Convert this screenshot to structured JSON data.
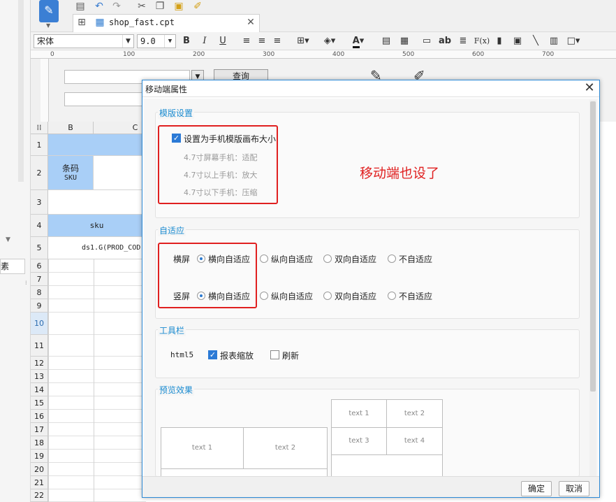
{
  "left_panel": {
    "tab_label": "素"
  },
  "file_tab": {
    "name": "shop_fast.cpt"
  },
  "format_bar": {
    "font_name": "宋体",
    "font_size": "9.0",
    "bold": "B",
    "italic": "I",
    "underline": "U",
    "font_color_label": "A",
    "ab_label": "ab",
    "fx_label": "F(x)"
  },
  "ruler": {
    "ticks": [
      "0",
      "100",
      "200",
      "300",
      "400",
      "500",
      "600",
      "700"
    ]
  },
  "param_pane": {
    "query_button": "查询"
  },
  "sheet": {
    "columns": [
      "B",
      "C"
    ],
    "rows": [
      "1",
      "2",
      "3",
      "4",
      "5",
      "6",
      "7",
      "8",
      "9",
      "10",
      "11",
      "12",
      "13",
      "14",
      "15",
      "16",
      "17",
      "18",
      "19",
      "20",
      "21",
      "22"
    ],
    "cell_barcode": "条码",
    "cell_sku_upper": "SKU",
    "cell_sku": "sku",
    "cell_formula": "ds1.G(PROD_COD"
  },
  "dialog": {
    "title": "移动端属性",
    "template": {
      "title": "模版设置",
      "checkbox_label": "设置为手机模版画布大小",
      "lines": [
        "4.7寸屏幕手机：适配",
        "4.7寸以上手机：放大",
        "4.7寸以下手机：压缩"
      ]
    },
    "annotation": "移动端也设了",
    "adaptive": {
      "title": "自适应",
      "landscape_label": "横屏",
      "portrait_label": "竖屏",
      "options": [
        "横向自适应",
        "纵向自适应",
        "双向自适应",
        "不自适应"
      ]
    },
    "toolbar": {
      "title": "工具栏",
      "html5_label": "html5",
      "zoom_label": "报表缩放",
      "refresh_label": "刷新"
    },
    "preview": {
      "title": "预览效果",
      "cells_left": [
        "text 1",
        "text 2"
      ],
      "cells_right": [
        "text 1",
        "text 2",
        "text 3",
        "text 4"
      ]
    },
    "ok_button": "确定",
    "cancel_button": "取消"
  }
}
